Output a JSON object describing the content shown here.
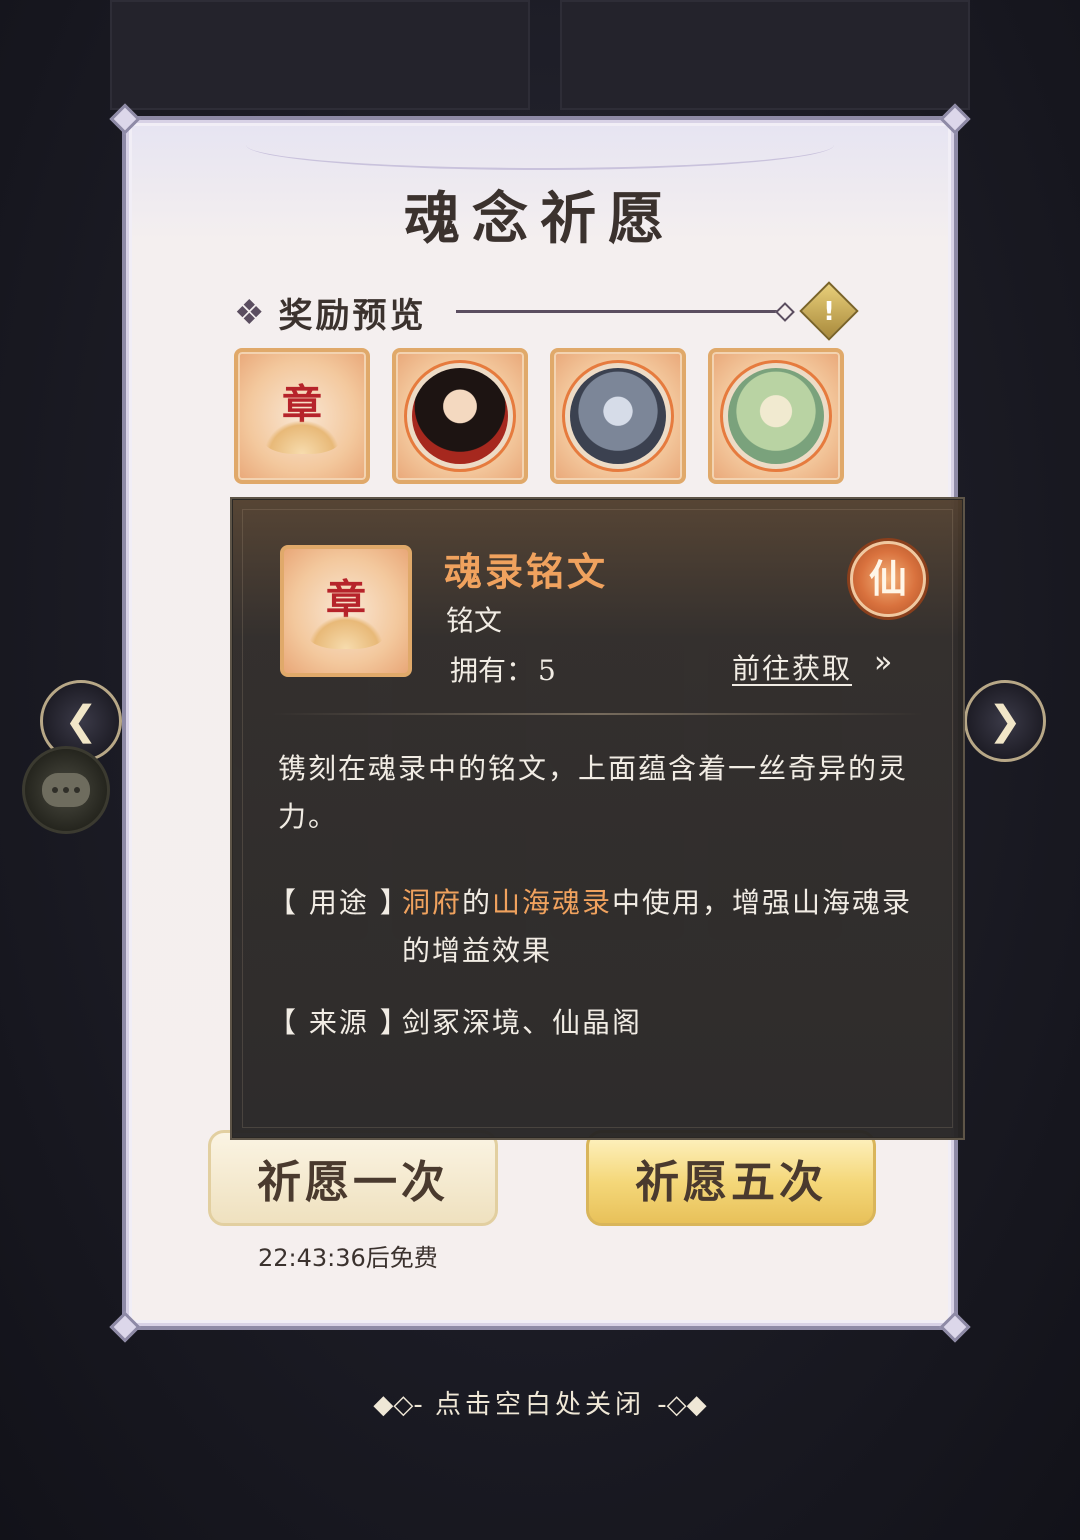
{
  "window": {
    "title": "魂念祈愿"
  },
  "rewards": {
    "label": "奖励预览",
    "items": [
      {
        "name": "魂录铭文",
        "icon": "inscription-lotus-icon"
      },
      {
        "name": "",
        "icon": "portrait-red-robe"
      },
      {
        "name": "",
        "icon": "portrait-silver-hair"
      },
      {
        "name": "",
        "icon": "portrait-green-hair"
      }
    ]
  },
  "buttons": {
    "wish_one": "祈愿一次",
    "wish_five": "祈愿五次",
    "free_timer": "22:43:36后免费"
  },
  "tooltip": {
    "name": "魂录铭文",
    "type": "铭文",
    "own_label": "拥有：",
    "own_count": "5",
    "goto_label": "前往获取",
    "goto_arrow": "»",
    "rank_badge": "仙",
    "description": "镌刻在魂录中的铭文，上面蕴含着一丝奇异的灵力。",
    "usage_label": "【 用途 】",
    "usage_part1": "洞府",
    "usage_part2": "的",
    "usage_part3": "山海魂录",
    "usage_part4": "中使用，增强山海魂录的增益效果",
    "source_label": "【 来源 】",
    "source_value": "剑冢深境、仙晶阁"
  },
  "hint": {
    "close": "点击空白处关闭",
    "dec_left": "◆◇-",
    "dec_right": "-◇◆"
  },
  "colors": {
    "accent_orange": "#f0a25e",
    "rank_badge": "#d9723e",
    "card_border": "#8e8aa6",
    "gold_button": "#f4d779"
  }
}
